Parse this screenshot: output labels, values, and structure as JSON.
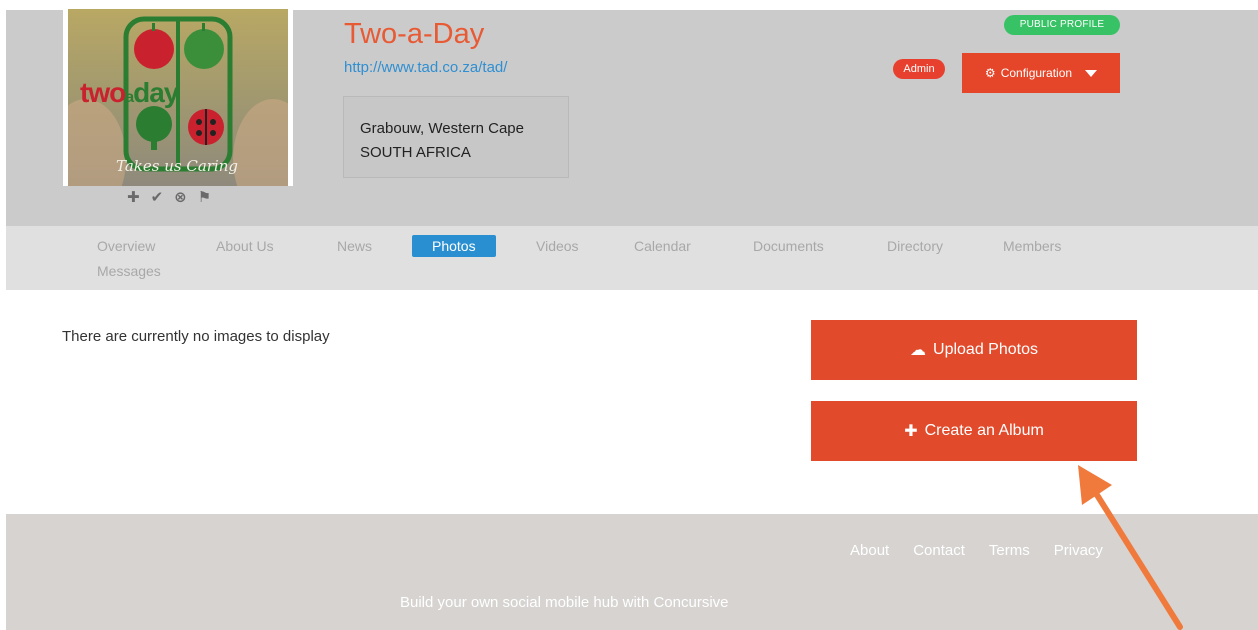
{
  "header": {
    "org_name": "Two-a-Day",
    "org_url": "http://www.tad.co.za/tad/",
    "address_line1": "Grabouw, Western Cape",
    "address_line2": "SOUTH AFRICA",
    "public_badge": "PUBLIC PROFILE",
    "admin_badge": "Admin",
    "config_label": "Configuration"
  },
  "logo": {
    "brand_two": "two",
    "brand_a": "a",
    "brand_day": "day",
    "tagline": "Takes us Caring"
  },
  "profile_actions": [
    "add-icon",
    "check-icon",
    "block-icon",
    "flag-icon"
  ],
  "tabs": [
    {
      "label": "Overview"
    },
    {
      "label": "About Us"
    },
    {
      "label": "News"
    },
    {
      "label": "Photos"
    },
    {
      "label": "Videos"
    },
    {
      "label": "Calendar"
    },
    {
      "label": "Documents"
    },
    {
      "label": "Directory"
    },
    {
      "label": "Members"
    },
    {
      "label": "Messages"
    }
  ],
  "active_tab": "Photos",
  "content": {
    "empty_message": "There are currently no images to display",
    "upload_label": "Upload Photos",
    "album_label": "Create an Album"
  },
  "footer": {
    "links": [
      "About",
      "Contact",
      "Terms",
      "Privacy"
    ],
    "tagline": "Build your own social mobile hub with Concursive"
  },
  "colors": {
    "accent": "#e24a2c",
    "link": "#2f8fd2",
    "active_tab": "#2a8fd0",
    "public_badge": "#37c266",
    "arrow": "#f07a3c"
  }
}
